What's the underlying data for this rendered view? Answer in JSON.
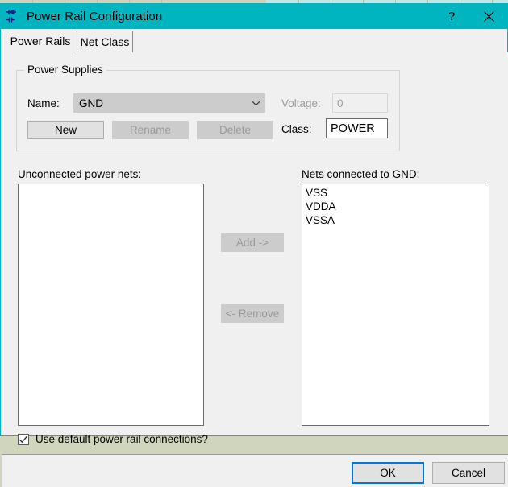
{
  "window": {
    "title": "Power Rail Configuration",
    "icon": "power-rail-icon",
    "titlebar_color": "#00b5c0",
    "help_label": "?",
    "close_label": "close-icon"
  },
  "tabs": [
    {
      "label": "Power Rails",
      "name": "tab-power-rails",
      "selected": true
    },
    {
      "label": "Net Class",
      "name": "tab-net-class",
      "selected": false
    }
  ],
  "group": {
    "legend": "Power Supplies",
    "name_label": "Name:",
    "name_value": "GND",
    "name_options": [
      "GND"
    ],
    "voltage_label": "Voltage:",
    "voltage_value": "0",
    "voltage_enabled": false,
    "class_label": "Class:",
    "class_value": "POWER",
    "buttons": [
      {
        "label": "New",
        "enabled": true
      },
      {
        "label": "Rename",
        "enabled": false
      },
      {
        "label": "Delete",
        "enabled": false
      }
    ]
  },
  "lists": {
    "unconnected_label": "Unconnected power nets:",
    "unconnected_items": [],
    "connected_label": "Nets connected to GND:",
    "connected_items": [
      "VSS",
      "VDDA",
      "VSSA"
    ]
  },
  "transfer": {
    "add_label": "Add ->",
    "add_enabled": false,
    "remove_label": "<- Remove",
    "remove_enabled": false
  },
  "checkbox": {
    "label": "Use default power rail connections?",
    "checked": true
  },
  "footer": {
    "ok_label": "OK",
    "cancel_label": "Cancel",
    "default_button": "OK",
    "focus_color": "#0078d7"
  }
}
